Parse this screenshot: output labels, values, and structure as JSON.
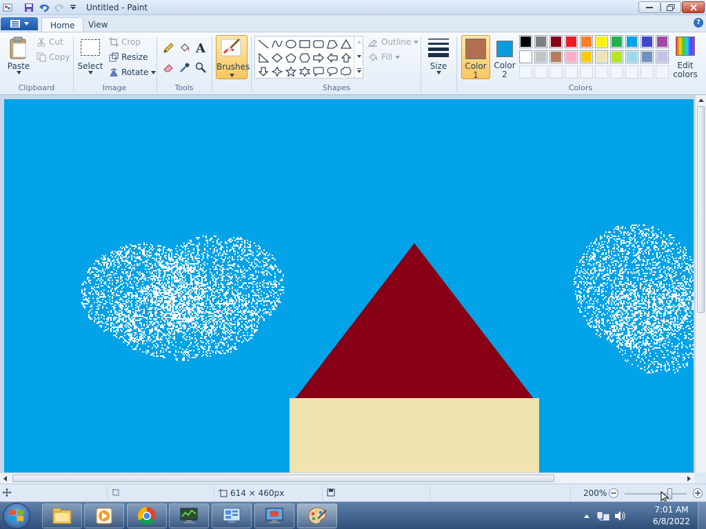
{
  "window": {
    "title": "Untitled - Paint"
  },
  "tabs": [
    "Home",
    "View"
  ],
  "ribbon": {
    "clipboard": {
      "label": "Clipboard",
      "paste": "Paste",
      "cut": "Cut",
      "copy": "Copy"
    },
    "image": {
      "label": "Image",
      "select": "Select",
      "crop": "Crop",
      "resize": "Resize",
      "rotate": "Rotate"
    },
    "tools": {
      "label": "Tools"
    },
    "brushes": {
      "label": "Brushes"
    },
    "shapes": {
      "label": "Shapes",
      "outline": "Outline",
      "fill": "Fill"
    },
    "size": {
      "label": "Size"
    },
    "color1": {
      "label": "Color",
      "number": "1",
      "value": "#b07050"
    },
    "color2": {
      "label": "Color",
      "number": "2",
      "value": "#0d9bdf"
    },
    "colors": {
      "label": "Colors",
      "edit_label_1": "Edit",
      "edit_label_2": "colors",
      "palette_row1": [
        "#000000",
        "#7f7f7f",
        "#880015",
        "#ed1c24",
        "#ff7f27",
        "#fff200",
        "#22b14c",
        "#00a2e8",
        "#3f48cc",
        "#a349a4"
      ],
      "palette_row2": [
        "#ffffff",
        "#c3c3c3",
        "#b97a57",
        "#ffaec9",
        "#ffc90e",
        "#efe4b0",
        "#b5e61d",
        "#99d9ea",
        "#7092be",
        "#c8bfe7"
      ]
    }
  },
  "canvas_colors": {
    "sky": "#00a2e8",
    "roof": "#880015",
    "wall": "#efe4b0",
    "cloud": "#ffffff"
  },
  "status": {
    "dimensions": "614 × 460px",
    "zoom": "200%",
    "zoom_fraction": 0.73
  },
  "taskbar": {
    "time": "7:01 AM",
    "date": "6/8/2022"
  }
}
